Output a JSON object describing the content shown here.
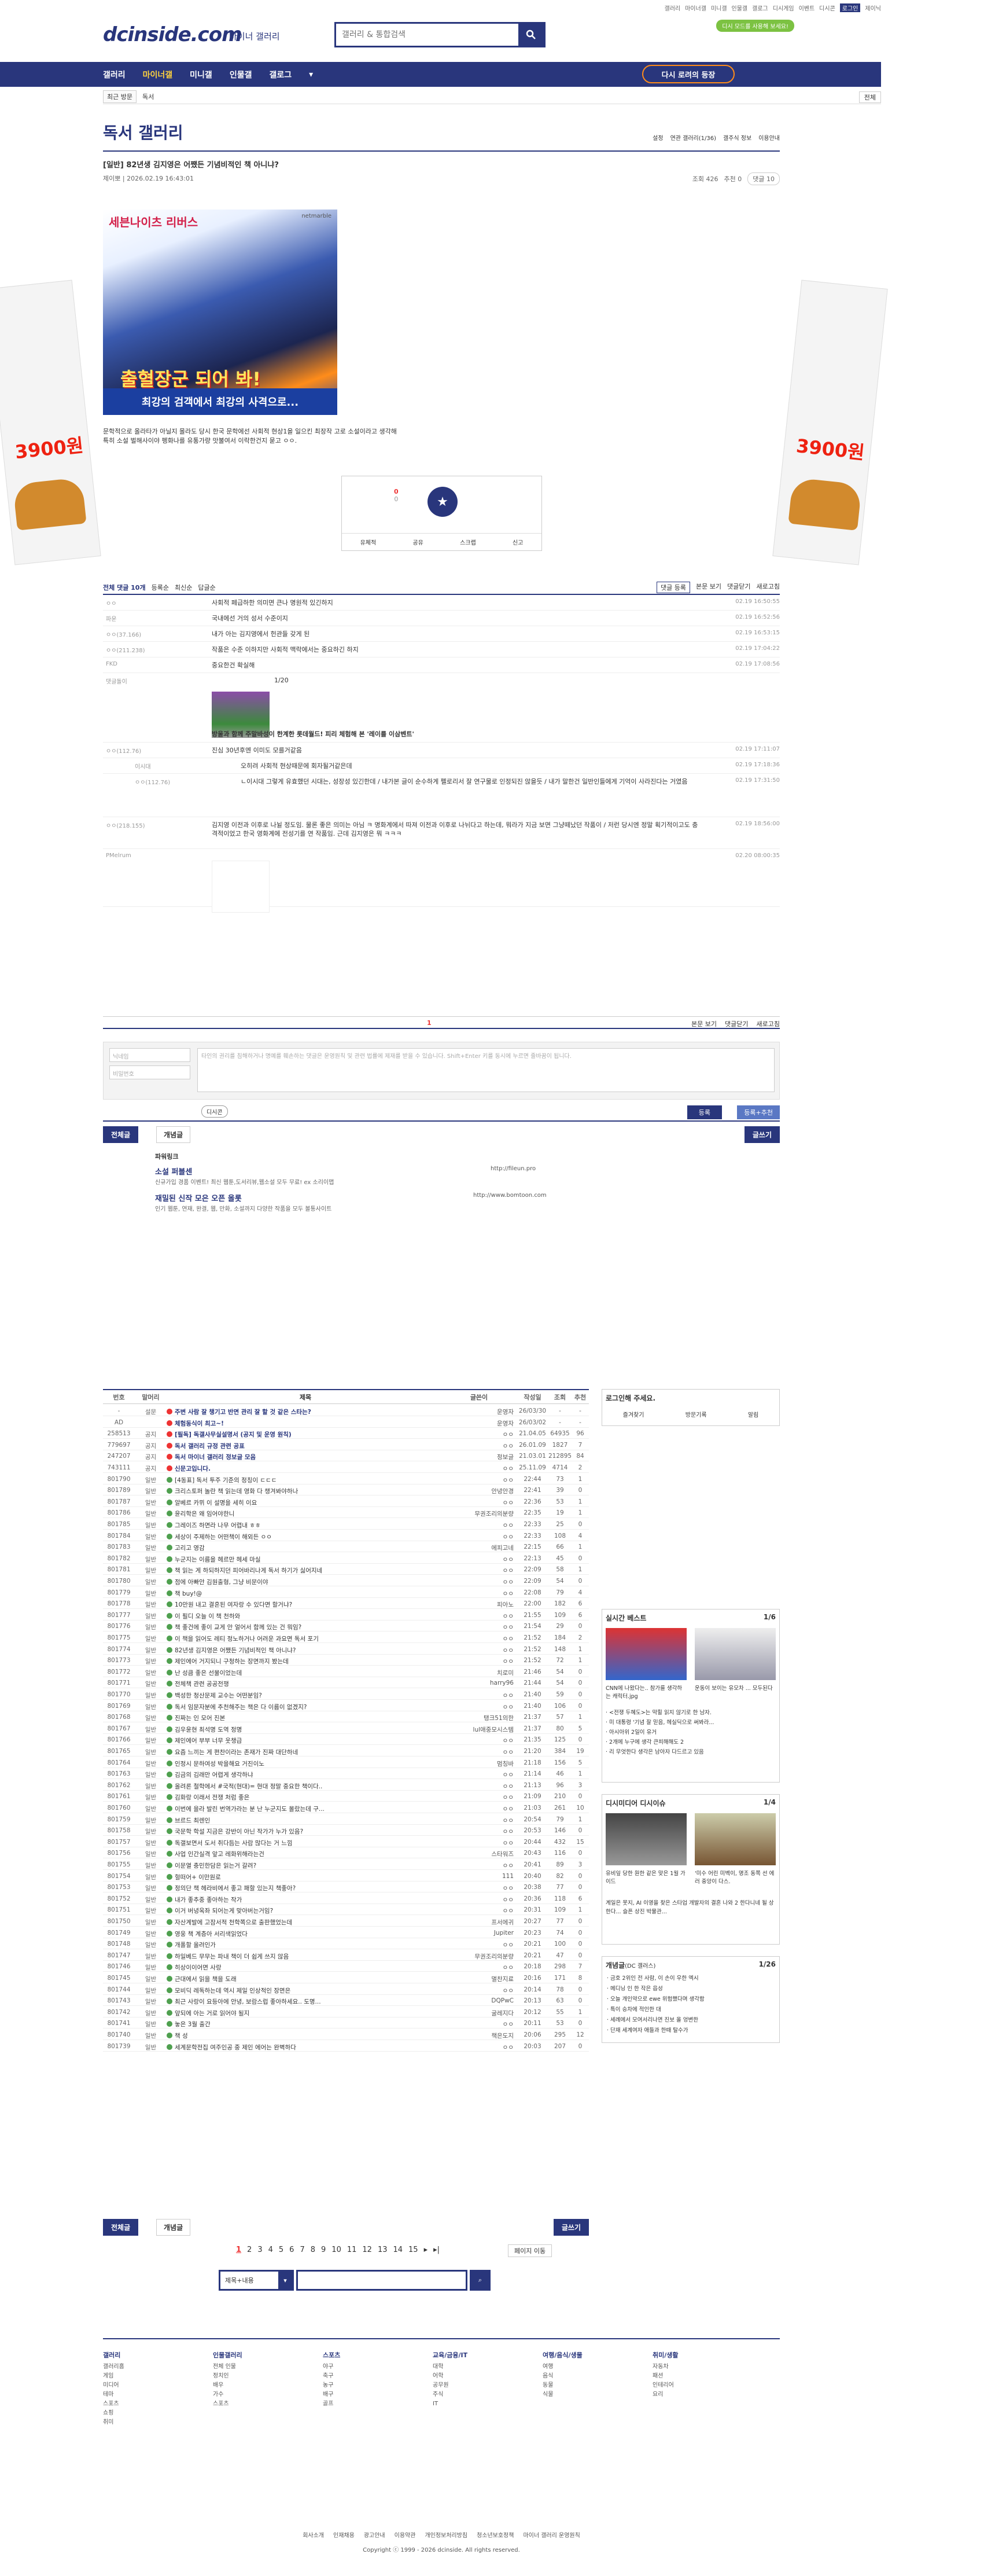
{
  "toplinks": [
    "갤러리",
    "마이너갤",
    "미니갤",
    "인물갤",
    "갤로그",
    "디시게임",
    "이벤트",
    "디시콘",
    "로그인",
    "제이닉"
  ],
  "promo": "디시 모드를 사용해 보세요!",
  "logo": "dcinside.com",
  "logo_sub": "마이너 갤러리",
  "search_placeholder": "갤러리 & 통합검색",
  "nav": [
    "갤러리",
    "마이너갤",
    "미니갤",
    "인물갤",
    "갤로그"
  ],
  "revisit": "다시 로려의 등장",
  "subnav": {
    "back": "최근 방문",
    "name": "독서",
    "right": "전체"
  },
  "gallery_title": "독서 갤러리",
  "gtools": [
    "설정",
    "연관 갤러리(1/36)",
    "갤주식 정보",
    "이용안내"
  ],
  "post": {
    "title": "[일반] 82년생 김지영은 어쨌든 기념비적인 책 아니냐?",
    "author": "제이뽀",
    "date": "2026.02.19 16:43:01",
    "views": "조회 426",
    "recs": "추천 0",
    "comments": "댓글 10",
    "body": "문학적으로 올라타가 아닐지 몰라도 당시 한국 문학에선 사회적 현상1을 일으킨 최장작 고로 소설이라고 생각해",
    "body2": "특히 소설 벌해사이야 펭화나를 유통가량 맛불여서 이락한건지 묻고 ㅇㅇ."
  },
  "ad": {
    "brand": "세븐나이츠 리버스",
    "pub": "netmarble",
    "head": "출혈장군 되어 봐!",
    "foot": "최강의 검객에서 최강의 사격으로..."
  },
  "rec": {
    "up": "0",
    "down": "0",
    "buttons": [
      "유체적",
      "공유",
      "스크랩",
      "신고"
    ]
  },
  "comments_head": {
    "total": "전체 댓글 10개",
    "opts": [
      "등록순",
      "최신순",
      "답글순"
    ],
    "right": [
      "댓글 등록",
      "본문 보기",
      "댓글닫기",
      "새로고침"
    ]
  },
  "comments": [
    {
      "w": "ㅇㅇ",
      "t": "사회적 페급하한 의미면 큰나 명원적 있긴하지",
      "d": "02.19 16:50:55"
    },
    {
      "w": "파운",
      "t": "국내에선 거의 성서 수준이지",
      "d": "02.19 16:52:56"
    },
    {
      "w": "ㅇㅇ(37.166)",
      "t": "내가 아는 김지영에서 헌관들 갖게 된",
      "d": "02.19 16:53:15"
    },
    {
      "w": "ㅇㅇ(211.238)",
      "t": "작품은 수준 이하지만 사회적 맥락에서는 중요하긴 하지",
      "d": "02.19 17:04:22"
    },
    {
      "w": "FKD",
      "t": "중요한건 확실해",
      "d": "02.19 17:08:56"
    },
    {
      "w": "댓글돌이",
      "t": "방울과 함께 주말바성이 한계한 롯데월드! 피리 체험해 본 '레이를 이삼벤트'",
      "d": ""
    },
    {
      "w": "ㅇㅇ(112.76)",
      "t": "진심 30년후엔 이미도 모를거같음",
      "d": "02.19 17:11:07"
    },
    {
      "w": "이시대",
      "t": "오히려 사회적 현상때문에 회자될거같은데",
      "d": "02.19 17:18:36"
    },
    {
      "w": "ㅇㅇ(112.76)",
      "t": "ㄴ이시대 그렇게 유효했던 시대는, 성장성 있긴한데 / 내가본 글이 순수하게 펠로리서 잘 연구물로 인정되진 않을듯 / 내가 말한건 일반인들에게 기억이 사라진다는 거였음",
      "d": "02.19 17:31:50"
    },
    {
      "w": "ㅇㅇ(218.155)",
      "t": "김지영 이전과 이후로 나뉠 정도임. 물론 좋은 의미는 아님 ㅋ 명화계에서 따져 이전과 이후로 나뉘다고 하는데, 뭐라가 지금 보면 그냥떼났던 작품이 / 저런 당시엔 정말 획기적이고도 충격적이었고 한국 영화계에 전성기를 연 작품임. 근데 김지영은 뭐 ㅋㅋㅋ",
      "d": "02.19 18:56:00"
    },
    {
      "w": "PMelrum",
      "t": "",
      "d": "02.20 08:00:35"
    }
  ],
  "ad_comment": "1/20",
  "pager1": {
    "page": "1",
    "right": [
      "본문 보기",
      "댓글닫기",
      "새로고침"
    ]
  },
  "cform": {
    "nick": "닉네임",
    "pw": "비밀번호",
    "ta": "타인의 권리를 침해하거나 명예를 훼손하는 댓글은 운영원칙 및 관련 법률에 제재를 받을 수 있습니다. Shift+Enter 키를 동시에 누르면 줄바꿈이 됩니다.",
    "dc": "디시콘",
    "reg": "등록",
    "reg2": "등록+추천"
  },
  "tabs": {
    "all": "전체글",
    "best": "개념글",
    "write": "글쓰기"
  },
  "pw": {
    "h": "파워링크",
    "a1": "소설 퍼블센",
    "d1": "신규가입 경품 이벤트! 최신 웹툰,도서리뷰,웹소설 모두 무료! ex 소리이맵",
    "u1": "http://fileun.pro",
    "a2": "재밀된 신작 모은 오픈 올롯",
    "d2": "인기 웹툰, 연재, 완결, 웹, 만화, 소설까지 다양한 작품을 모두 볼통사이트",
    "u2": "http://www.bomtoon.com"
  },
  "list_head": [
    "번호",
    "말머리",
    "제목",
    "글쓴이",
    "작성일",
    "조회",
    "추천"
  ],
  "rows": [
    {
      "no": "-",
      "h": "설문",
      "t": "주변 사람 잘 챙기고 반면 관리 잘 할 것 같은 스타는?",
      "w": "운영자",
      "d": "26/03/30",
      "v": "-",
      "r": "-",
      "n": 1
    },
    {
      "no": "AD",
      "h": "",
      "t": "체험동식이 최고~!",
      "w": "운영자",
      "d": "26/03/02",
      "v": "-",
      "r": "-",
      "n": 1
    },
    {
      "no": "258513",
      "h": "공지",
      "t": "[필독] 독갤사무실설명서 (공지 및 운영 원칙)",
      "w": "ㅇㅇ",
      "d": "21.04.05",
      "v": "64935",
      "r": "96",
      "n": 1
    },
    {
      "no": "779697",
      "h": "공지",
      "t": "독서 갤러리 규정 관련 공표",
      "w": "ㅇㅇ",
      "d": "26.01.09",
      "v": "1827",
      "r": "7",
      "n": 1
    },
    {
      "no": "247207",
      "h": "공지",
      "t": "독서 마이너 갤러리 정보글 모음",
      "w": "정보글",
      "d": "21.03.01",
      "v": "212895",
      "r": "84",
      "n": 1
    },
    {
      "no": "743111",
      "h": "공지",
      "t": "신문고입니다.",
      "w": "ㅇㅇ",
      "d": "25.11.09",
      "v": "4714",
      "r": "2",
      "n": 1
    },
    {
      "no": "801790",
      "h": "일반",
      "t": "[4동표] 독서 투주 기준의 정칭이 ㄷㄷㄷ",
      "w": "ㅇㅇ",
      "d": "22:44",
      "v": "73",
      "r": "1",
      "n": 0
    },
    {
      "no": "801789",
      "h": "일반",
      "t": "크리스토퍼 놀란 책 읽는데 영화 다 챙겨봐야하나",
      "w": "안녕안경",
      "d": "22:41",
      "v": "39",
      "r": "0",
      "n": 0
    },
    {
      "no": "801787",
      "h": "일반",
      "t": "알베르 카뮈 이 설명을 세히 이요",
      "w": "ㅇㅇ",
      "d": "22:36",
      "v": "53",
      "r": "1",
      "n": 0
    },
    {
      "no": "801786",
      "h": "일반",
      "t": "윤리학은 왜 임어야한니",
      "w": "무권조리의분량",
      "d": "22:35",
      "v": "19",
      "r": "1",
      "n": 0
    },
    {
      "no": "801785",
      "h": "일반",
      "t": "그레이즈 하면라 나무 어렵내 ㅎㅎ",
      "w": "ㅇㅇ",
      "d": "22:33",
      "v": "25",
      "r": "0",
      "n": 0
    },
    {
      "no": "801784",
      "h": "일반",
      "t": "세상이 주제하는 어떤책이 해외든 ㅇㅇ",
      "w": "ㅇㅇ",
      "d": "22:33",
      "v": "108",
      "r": "4",
      "n": 0
    },
    {
      "no": "801783",
      "h": "일반",
      "t": "고리고 영감",
      "w": "에피고네",
      "d": "22:15",
      "v": "66",
      "r": "1",
      "n": 0
    },
    {
      "no": "801782",
      "h": "일반",
      "t": "누군지는 이름을 헤르만 헤세 마실",
      "w": "ㅇㅇ",
      "d": "22:13",
      "v": "45",
      "r": "0",
      "n": 0
    },
    {
      "no": "801781",
      "h": "일반",
      "t": "책 읽는 게 하되하지던 피어바리나게 독서 하기가 싫어지네",
      "w": "ㅇㅇ",
      "d": "22:09",
      "v": "58",
      "r": "1",
      "n": 0
    },
    {
      "no": "801780",
      "h": "일반",
      "t": "점에 아빠안 김원출형, 그냥 비문이야",
      "w": "ㅇㅇ",
      "d": "22:09",
      "v": "54",
      "r": "0",
      "n": 0
    },
    {
      "no": "801779",
      "h": "일반",
      "t": "책 buy!@",
      "w": "ㅇㅇ",
      "d": "22:08",
      "v": "79",
      "r": "4",
      "n": 0
    },
    {
      "no": "801778",
      "h": "일반",
      "t": "10만원 내고 결혼된 여자랑 수 있다면 할거냐?",
      "w": "피아노",
      "d": "22:00",
      "v": "182",
      "r": "6",
      "n": 0
    },
    {
      "no": "801777",
      "h": "일반",
      "t": "이 필디 오늘 이 책 천하와",
      "w": "ㅇㅇ",
      "d": "21:55",
      "v": "109",
      "r": "6",
      "n": 0
    },
    {
      "no": "801776",
      "h": "일반",
      "t": "책 좋건에 좋이 교게 안 얼어서 함께 있는 건 뭐임?",
      "w": "ㅇㅇ",
      "d": "21:54",
      "v": "29",
      "r": "0",
      "n": 0
    },
    {
      "no": "801775",
      "h": "일반",
      "t": "이 책을 읽어도 레티 정노하거나 어려운 과요면 독서 포기",
      "w": "ㅇㅇ",
      "d": "21:52",
      "v": "184",
      "r": "2",
      "n": 0
    },
    {
      "no": "801774",
      "h": "일반",
      "t": "82년생 김지영은 어쨌든 기념비적인 책 아니냐?",
      "w": "ㅇㅇ",
      "d": "21:52",
      "v": "148",
      "r": "1",
      "n": 0
    },
    {
      "no": "801773",
      "h": "일반",
      "t": "제인에어 거지되니 구청하는 장면까지 봤는데",
      "w": "ㅇㅇ",
      "d": "21:52",
      "v": "72",
      "r": "1",
      "n": 0
    },
    {
      "no": "801772",
      "h": "일반",
      "t": "난 성큼 좋은 선물이었는데",
      "w": "치로미",
      "d": "21:46",
      "v": "54",
      "r": "0",
      "n": 0
    },
    {
      "no": "801771",
      "h": "일반",
      "t": "전체책 관련 공공전쟁",
      "w": "harry96",
      "d": "21:44",
      "v": "54",
      "r": "0",
      "n": 0
    },
    {
      "no": "801770",
      "h": "일반",
      "t": "백성한 청산문제 교수는 어떤분임?",
      "w": "ㅇㅇ",
      "d": "21:40",
      "v": "59",
      "r": "0",
      "n": 0
    },
    {
      "no": "801769",
      "h": "일반",
      "t": "독서 임문자분에 추천해주는 책은 다 이름이 없겠지?",
      "w": "ㅇㅇ",
      "d": "21:40",
      "v": "106",
      "r": "0",
      "n": 0
    },
    {
      "no": "801768",
      "h": "일반",
      "t": "진짜는 인 모어 진본",
      "w": "탱크51의한",
      "d": "21:37",
      "v": "57",
      "r": "1",
      "n": 0
    },
    {
      "no": "801767",
      "h": "일반",
      "t": "김우윤현 최석명 도역 정명",
      "w": "lul애중모시스템",
      "d": "21:37",
      "v": "80",
      "r": "5",
      "n": 0
    },
    {
      "no": "801766",
      "h": "일반",
      "t": "제인에어 부부 너무 웃챙급",
      "w": "ㅇㅇ",
      "d": "21:35",
      "v": "125",
      "r": "0",
      "n": 0
    },
    {
      "no": "801765",
      "h": "일반",
      "t": "요즘 느끼는 게 편찬이라는 존재가 진짜 대단하네",
      "w": "ㅇㅇ",
      "d": "21:20",
      "v": "384",
      "r": "19",
      "n": 0
    },
    {
      "no": "801764",
      "h": "일반",
      "t": "인정시 문하여성 박을해요 거진이노",
      "w": "멈칭바",
      "d": "21:18",
      "v": "156",
      "r": "5",
      "n": 0
    },
    {
      "no": "801763",
      "h": "일반",
      "t": "김금의 김래만 어렵게 생각하냐",
      "w": "ㅇㅇ",
      "d": "21:14",
      "v": "46",
      "r": "1",
      "n": 0
    },
    {
      "no": "801762",
      "h": "일반",
      "t": "올려론 철학에서 #국적(현대)= 현대 정말 중요한 책이다..",
      "w": "ㅇㅇ",
      "d": "21:13",
      "v": "96",
      "r": "3",
      "n": 0
    },
    {
      "no": "801761",
      "h": "일반",
      "t": "김화랑 이래서 전쟁 처럼 좋은",
      "w": "ㅇㅇ",
      "d": "21:09",
      "v": "210",
      "r": "0",
      "n": 0
    },
    {
      "no": "801760",
      "h": "일반",
      "t": "이번에 을라 발린 번역가라는 분 난 누군지도 몰랐는데 구...",
      "w": "ㅇㅇ",
      "d": "21:03",
      "v": "261",
      "r": "10",
      "n": 0
    },
    {
      "no": "801759",
      "h": "일반",
      "t": "브르드 최렌인",
      "w": "ㅇㅇ",
      "d": "20:54",
      "v": "79",
      "r": "1",
      "n": 0
    },
    {
      "no": "801758",
      "h": "일반",
      "t": "국문학 학설 지금은 강반이 아닌 작가가 누가 있음?",
      "w": "ㅇㅇ",
      "d": "20:53",
      "v": "146",
      "r": "0",
      "n": 0
    },
    {
      "no": "801757",
      "h": "일반",
      "t": "독갤보면서 도서 취다듬는 사람 많다는 거 느낌",
      "w": "ㅇㅇ",
      "d": "20:44",
      "v": "432",
      "r": "15",
      "n": 0
    },
    {
      "no": "801756",
      "h": "일반",
      "t": "사업 인간실격 앞고 레화위해라는건",
      "w": "스타워즈",
      "d": "20:43",
      "v": "116",
      "r": "0",
      "n": 0
    },
    {
      "no": "801755",
      "h": "일반",
      "t": "이문열 충민한담은 읽는거 갈려?",
      "w": "ㅇㅇ",
      "d": "20:41",
      "v": "89",
      "r": "3",
      "n": 0
    },
    {
      "no": "801754",
      "h": "일반",
      "t": "헐떠어+ 이만원로",
      "w": "111",
      "d": "20:40",
      "v": "82",
      "r": "0",
      "n": 0
    },
    {
      "no": "801753",
      "h": "일반",
      "t": "정의단 책 헤라비에서 좋고 패할 있는지 책좋아?",
      "w": "ㅇㅇ",
      "d": "20:38",
      "v": "77",
      "r": "0",
      "n": 0
    },
    {
      "no": "801752",
      "h": "일반",
      "t": "내가 좋추중 좋아하는 작가",
      "w": "ㅇㅇ",
      "d": "20:36",
      "v": "118",
      "r": "6",
      "n": 0
    },
    {
      "no": "801751",
      "h": "일반",
      "t": "이거 버녕옥좌 되어는게 맞아버는거임?",
      "w": "ㅇㅇ",
      "d": "20:31",
      "v": "109",
      "r": "1",
      "n": 0
    },
    {
      "no": "801750",
      "h": "일반",
      "t": "자산계발에 고잠서적 천학쪽으로 출판했었는데",
      "w": "프서에귀 ",
      "d": "20:27",
      "v": "77",
      "r": "0",
      "n": 0
    },
    {
      "no": "801749",
      "h": "일반",
      "t": "영웅 책 계층아 서리색읽었다",
      "w": "Jupiter",
      "d": "20:23",
      "v": "74",
      "r": "0",
      "n": 0
    },
    {
      "no": "801748",
      "h": "일반",
      "t": "개폴할 올려인가",
      "w": "ㅇㅇ",
      "d": "20:21",
      "v": "100",
      "r": "0",
      "n": 0
    },
    {
      "no": "801747",
      "h": "일반",
      "t": "하일베드 무무는 파내 책이 더 쉽게 쓰지 않음",
      "w": "무권조리의분량",
      "d": "20:21",
      "v": "47",
      "r": "0",
      "n": 0
    },
    {
      "no": "801746",
      "h": "일반",
      "t": "히상이이어면 사랑",
      "w": "ㅇㅇ",
      "d": "20:18",
      "v": "298",
      "r": "7",
      "n": 0
    },
    {
      "no": "801745",
      "h": "일반",
      "t": "근대에서 읽을 책을 도래",
      "w": "멸찬지료",
      "d": "20:16",
      "v": "171",
      "r": "8",
      "n": 0
    },
    {
      "no": "801744",
      "h": "일반",
      "t": "모비딕 레독하는데 역시 제일 인상적인 장면은",
      "w": "ㅇㅇ",
      "d": "20:14",
      "v": "78",
      "r": "0",
      "n": 0
    },
    {
      "no": "801743",
      "h": "일반",
      "t": "최근 사랑이 요등아에 안녕, 보람스럽 좋아하세요.. 도명...",
      "w": "DQPwC",
      "d": "20:13",
      "v": "63",
      "r": "0",
      "n": 0
    },
    {
      "no": "801742",
      "h": "일반",
      "t": "앞되에 아는 거로 읽어야 될지",
      "w": "굴레지다",
      "d": "20:12",
      "v": "55",
      "r": "1",
      "n": 0
    },
    {
      "no": "801741",
      "h": "일반",
      "t": "놓은 3월 출간",
      "w": "ㅇㅇ",
      "d": "20:11",
      "v": "53",
      "r": "0",
      "n": 0
    },
    {
      "no": "801740",
      "h": "일반",
      "t": "책 성",
      "w": "책은도지",
      "d": "20:06",
      "v": "295",
      "r": "12",
      "n": 0
    },
    {
      "no": "801739",
      "h": "일반",
      "t": "세계문학전집 여주인공 중 제인 에어는 완벽하다",
      "w": "ㅇㅇ",
      "d": "20:03",
      "v": "207",
      "r": "0",
      "n": 0
    }
  ],
  "pages": [
    "1",
    "2",
    "3",
    "4",
    "5",
    "6",
    "7",
    "8",
    "9",
    "10",
    "11",
    "12",
    "13",
    "14",
    "15"
  ],
  "jump": "페이지 이동",
  "search_sel": "제목+내용",
  "right": {
    "login": "로그인해 주세요.",
    "login_btns": [
      "즐겨찾기",
      "방문기록",
      "알림"
    ],
    "realtime": "실시간 베스트",
    "realtime_page": "1/6",
    "rb1": "CNN에 나왔다는.. 참가를 생각하는 캐릭터.jpg",
    "rb2": "운동이 보이는 유모차 ... 모두된다",
    "rb_list": [
      "<전쟁 두혜도>는 막힐 읽지 않기로 한 남자.",
      "미 대통령 '기념 잘 믿음, 헤실딕으로 써봐라...",
      "아시아위 2일이 유거",
      "2개에 누구에 생각 큰피해해도 2",
      "리 무엇한다 생각은 남아자 다드르고 있음"
    ],
    "digi": "디시미디어",
    "digi_title": "디시이슈",
    "digi_page": "1/4",
    "dg1": "유비잎 당한 원한 같은 맞은 1월 가이드",
    "dg2": "'미수 어린 미벡이, 명조 동쪽 선 에러 중앙이 다스.",
    "dg_text": "계일은 못지, AI 이영을 찾은 스타업 개발자의 결혼 나와 2 한다니네 될 상한다... 슬픈 상진 박물관...",
    "concept": "개념글",
    "concept_sub": "(DC 갤러스)",
    "concept_page": "1/26",
    "concept_list": [
      "금호 2위인 전 사람, 이 손이 우한 엑시",
      "메디닝 인 한 작은 읍성",
      "오늘 개인약으로 ewe 위험했다며 생각함",
      "특이 승차에 적인한 대",
      "세례에서 모여서리나면 진보 올 엉변한",
      "단재 세계여자 애들과 한때 탈수가"
    ]
  },
  "footer": [
    {
      "h": "갤러리",
      "items": [
        "갤러리홈",
        "게임",
        "미디어",
        "테마",
        "스포츠",
        "쇼핑",
        "취미"
      ]
    },
    {
      "h": "인물갤러리",
      "items": [
        "전체 인물",
        "정치인",
        "배우",
        "가수",
        "스포츠"
      ]
    },
    {
      "h": "스포츠",
      "items": [
        "야구",
        "축구",
        "농구",
        "배구",
        "골프"
      ]
    },
    {
      "h": "교육/금융/IT",
      "items": [
        "대학",
        "어학",
        "공무원",
        "주식",
        "IT"
      ]
    },
    {
      "h": "여행/음식/생물",
      "items": [
        "여행",
        "음식",
        "동물",
        "식물"
      ]
    },
    {
      "h": "취미/생활",
      "items": [
        "자동차",
        "패션",
        "인테리어",
        "요리"
      ]
    }
  ],
  "footer_links": [
    "회사소개",
    "인재채용",
    "광고안내",
    "이용약관",
    "개인정보처리방침",
    "청소년보호정책",
    "마이너 갤러리 운영원칙"
  ],
  "copyright": "Copyright ⓒ 1999 - 2026 dcinside. All rights reserved.",
  "side_price": "3900원"
}
